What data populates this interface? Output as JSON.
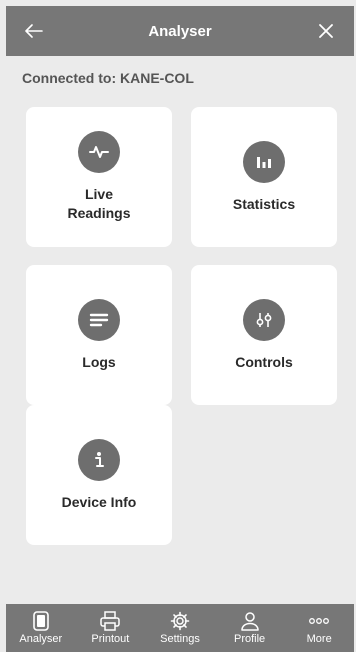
{
  "header": {
    "title": "Analyser",
    "back_icon": "arrow-left-icon",
    "close_icon": "close-icon"
  },
  "connection": {
    "text": "Connected to: KANE-COL"
  },
  "tiles": [
    {
      "label": "Live\nReadings",
      "icon": "pulse-icon"
    },
    {
      "label": "Statistics",
      "icon": "bar-chart-icon"
    },
    {
      "label": "Logs",
      "icon": "list-icon"
    },
    {
      "label": "Controls",
      "icon": "sliders-icon"
    },
    {
      "label": "Device Info",
      "icon": "info-icon"
    }
  ],
  "nav": [
    {
      "label": "Analyser",
      "icon": "device-icon"
    },
    {
      "label": "Printout",
      "icon": "printer-icon"
    },
    {
      "label": "Settings",
      "icon": "gear-icon"
    },
    {
      "label": "Profile",
      "icon": "person-icon"
    },
    {
      "label": "More",
      "icon": "more-icon"
    }
  ],
  "colors": {
    "bar": "#777777",
    "background": "#ebebeb",
    "tile": "#ffffff",
    "icon_circle": "#6e6e6e"
  }
}
